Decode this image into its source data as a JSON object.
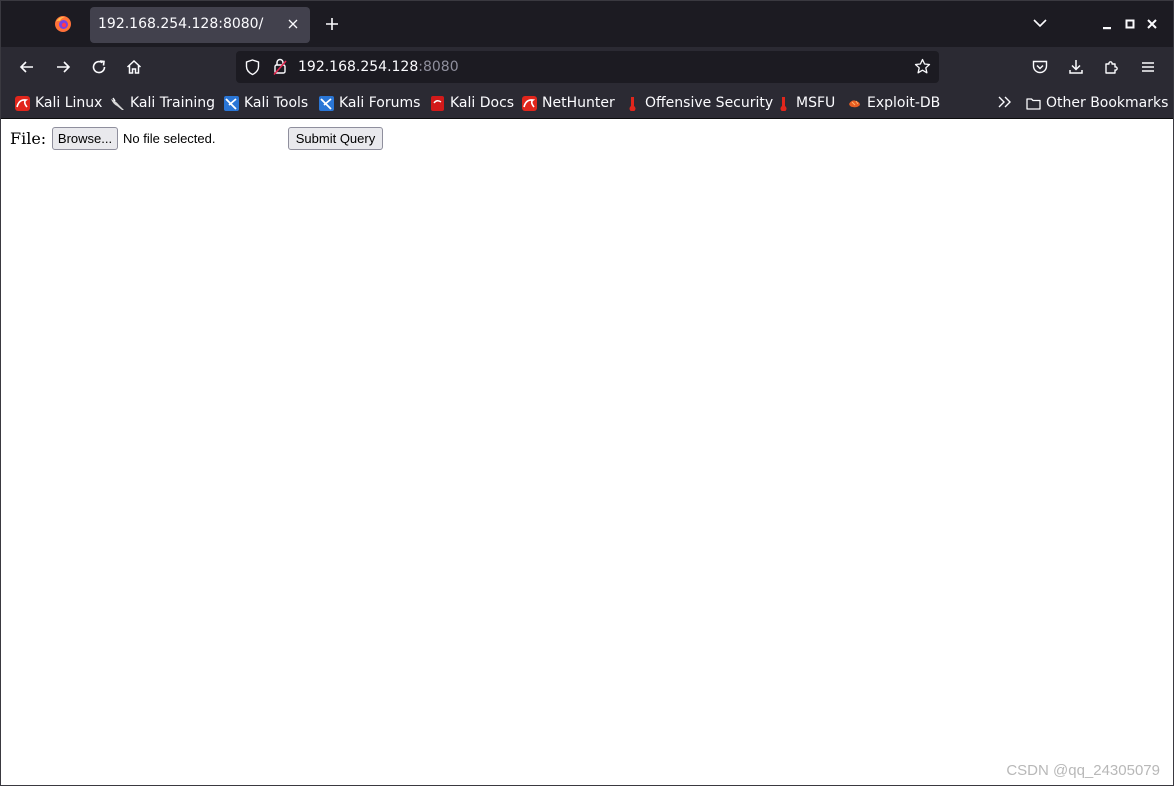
{
  "colors": {
    "tabstrip_bg": "#1c1b22",
    "toolbar_bg": "#2b2a33",
    "active_tab_bg": "#42414d",
    "text_light": "#fbfbfe",
    "text_dim": "#8f8f9d",
    "content_bg": "#ffffff"
  },
  "tabs": [
    {
      "title": "192.168.254.128:8080/",
      "active": true
    }
  ],
  "toolbar": {
    "url_host": "192.168.254.128",
    "url_port": ":8080",
    "icons": [
      "back-arrow-icon",
      "forward-arrow-icon",
      "reload-icon",
      "home-icon",
      "tracking-shield-icon",
      "insecure-lock-icon",
      "bookmark-star-icon",
      "pocket-icon",
      "downloads-icon",
      "extensions-icon",
      "menu-icon"
    ]
  },
  "bookmarks": {
    "items": [
      {
        "label": "Kali Linux",
        "icon": "kali-icon"
      },
      {
        "label": "Kali Training",
        "icon": "kali-training-icon"
      },
      {
        "label": "Kali Tools",
        "icon": "kali-tools-icon"
      },
      {
        "label": "Kali Forums",
        "icon": "kali-forums-icon"
      },
      {
        "label": "Kali Docs",
        "icon": "kali-docs-icon"
      },
      {
        "label": "NetHunter",
        "icon": "nethunter-icon"
      },
      {
        "label": "Offensive Security",
        "icon": "offsec-icon"
      },
      {
        "label": "MSFU",
        "icon": "msfu-icon"
      },
      {
        "label": "Exploit-DB",
        "icon": "exploitdb-icon"
      }
    ],
    "other_label": "Other Bookmarks"
  },
  "page": {
    "file_label": "File:",
    "browse_label": "Browse...",
    "file_status": "No file selected.",
    "submit_label": "Submit Query"
  },
  "watermark": "CSDN @qq_24305079"
}
